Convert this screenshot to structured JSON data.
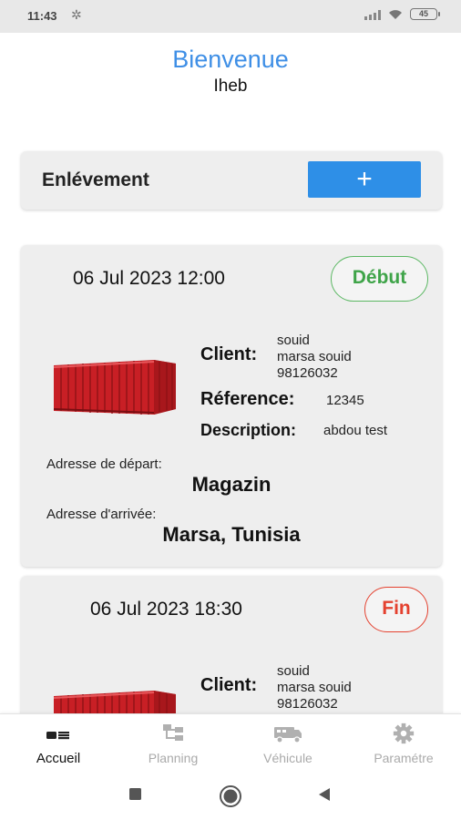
{
  "status_bar": {
    "time": "11:43",
    "battery": "45"
  },
  "header": {
    "welcome": "Bienvenue",
    "username": "Iheb"
  },
  "enlevement": {
    "label": "Enlévement",
    "add_button": "+"
  },
  "pickups": [
    {
      "datetime": "06 Jul 2023 12:00",
      "status": "Début",
      "client_label": "Client:",
      "client_lines": [
        "souid",
        "marsa souid",
        "98126032"
      ],
      "reference_label": "Réference:",
      "reference": "12345",
      "description_label": "Description:",
      "description": "abdou test",
      "departure_caption": "Adresse de départ:",
      "departure": "Magazin",
      "arrival_caption": "Adresse d'arrivée:",
      "arrival": "Marsa, Tunisia"
    },
    {
      "datetime": "06 Jul 2023 18:30",
      "status": "Fin",
      "client_label": "Client:",
      "client_lines": [
        "souid",
        "marsa souid",
        "98126032"
      ]
    }
  ],
  "bottom_nav": [
    {
      "label": "Accueil",
      "icon": "home-icon",
      "active": true
    },
    {
      "label": "Planning",
      "icon": "planning-icon",
      "active": false
    },
    {
      "label": "Véhicule",
      "icon": "truck-icon",
      "active": false
    },
    {
      "label": "Paramétre",
      "icon": "gear-icon",
      "active": false
    }
  ],
  "colors": {
    "accent_blue": "#2e8fe7",
    "status_start_green": "#3fa449",
    "status_end_red": "#e4412f",
    "card_bg": "#eeeeee",
    "container_red": "#d6262c"
  }
}
